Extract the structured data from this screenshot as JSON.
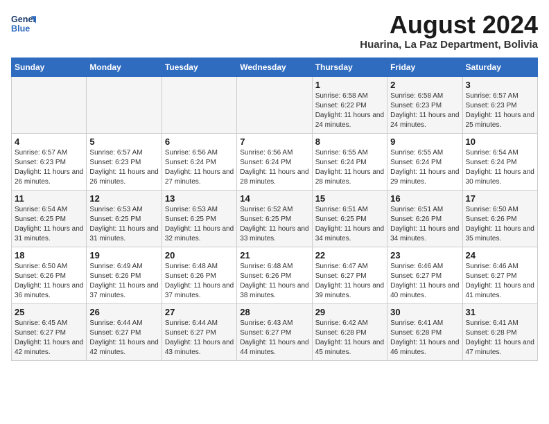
{
  "header": {
    "logo_line1": "General",
    "logo_line2": "Blue",
    "main_title": "August 2024",
    "subtitle": "Huarina, La Paz Department, Bolivia"
  },
  "days_of_week": [
    "Sunday",
    "Monday",
    "Tuesday",
    "Wednesday",
    "Thursday",
    "Friday",
    "Saturday"
  ],
  "weeks": [
    [
      {
        "day": "",
        "sunrise": "",
        "sunset": "",
        "daylight": ""
      },
      {
        "day": "",
        "sunrise": "",
        "sunset": "",
        "daylight": ""
      },
      {
        "day": "",
        "sunrise": "",
        "sunset": "",
        "daylight": ""
      },
      {
        "day": "",
        "sunrise": "",
        "sunset": "",
        "daylight": ""
      },
      {
        "day": "1",
        "sunrise": "Sunrise: 6:58 AM",
        "sunset": "Sunset: 6:22 PM",
        "daylight": "Daylight: 11 hours and 24 minutes."
      },
      {
        "day": "2",
        "sunrise": "Sunrise: 6:58 AM",
        "sunset": "Sunset: 6:23 PM",
        "daylight": "Daylight: 11 hours and 24 minutes."
      },
      {
        "day": "3",
        "sunrise": "Sunrise: 6:57 AM",
        "sunset": "Sunset: 6:23 PM",
        "daylight": "Daylight: 11 hours and 25 minutes."
      }
    ],
    [
      {
        "day": "4",
        "sunrise": "Sunrise: 6:57 AM",
        "sunset": "Sunset: 6:23 PM",
        "daylight": "Daylight: 11 hours and 26 minutes."
      },
      {
        "day": "5",
        "sunrise": "Sunrise: 6:57 AM",
        "sunset": "Sunset: 6:23 PM",
        "daylight": "Daylight: 11 hours and 26 minutes."
      },
      {
        "day": "6",
        "sunrise": "Sunrise: 6:56 AM",
        "sunset": "Sunset: 6:24 PM",
        "daylight": "Daylight: 11 hours and 27 minutes."
      },
      {
        "day": "7",
        "sunrise": "Sunrise: 6:56 AM",
        "sunset": "Sunset: 6:24 PM",
        "daylight": "Daylight: 11 hours and 28 minutes."
      },
      {
        "day": "8",
        "sunrise": "Sunrise: 6:55 AM",
        "sunset": "Sunset: 6:24 PM",
        "daylight": "Daylight: 11 hours and 28 minutes."
      },
      {
        "day": "9",
        "sunrise": "Sunrise: 6:55 AM",
        "sunset": "Sunset: 6:24 PM",
        "daylight": "Daylight: 11 hours and 29 minutes."
      },
      {
        "day": "10",
        "sunrise": "Sunrise: 6:54 AM",
        "sunset": "Sunset: 6:24 PM",
        "daylight": "Daylight: 11 hours and 30 minutes."
      }
    ],
    [
      {
        "day": "11",
        "sunrise": "Sunrise: 6:54 AM",
        "sunset": "Sunset: 6:25 PM",
        "daylight": "Daylight: 11 hours and 31 minutes."
      },
      {
        "day": "12",
        "sunrise": "Sunrise: 6:53 AM",
        "sunset": "Sunset: 6:25 PM",
        "daylight": "Daylight: 11 hours and 31 minutes."
      },
      {
        "day": "13",
        "sunrise": "Sunrise: 6:53 AM",
        "sunset": "Sunset: 6:25 PM",
        "daylight": "Daylight: 11 hours and 32 minutes."
      },
      {
        "day": "14",
        "sunrise": "Sunrise: 6:52 AM",
        "sunset": "Sunset: 6:25 PM",
        "daylight": "Daylight: 11 hours and 33 minutes."
      },
      {
        "day": "15",
        "sunrise": "Sunrise: 6:51 AM",
        "sunset": "Sunset: 6:25 PM",
        "daylight": "Daylight: 11 hours and 34 minutes."
      },
      {
        "day": "16",
        "sunrise": "Sunrise: 6:51 AM",
        "sunset": "Sunset: 6:26 PM",
        "daylight": "Daylight: 11 hours and 34 minutes."
      },
      {
        "day": "17",
        "sunrise": "Sunrise: 6:50 AM",
        "sunset": "Sunset: 6:26 PM",
        "daylight": "Daylight: 11 hours and 35 minutes."
      }
    ],
    [
      {
        "day": "18",
        "sunrise": "Sunrise: 6:50 AM",
        "sunset": "Sunset: 6:26 PM",
        "daylight": "Daylight: 11 hours and 36 minutes."
      },
      {
        "day": "19",
        "sunrise": "Sunrise: 6:49 AM",
        "sunset": "Sunset: 6:26 PM",
        "daylight": "Daylight: 11 hours and 37 minutes."
      },
      {
        "day": "20",
        "sunrise": "Sunrise: 6:48 AM",
        "sunset": "Sunset: 6:26 PM",
        "daylight": "Daylight: 11 hours and 37 minutes."
      },
      {
        "day": "21",
        "sunrise": "Sunrise: 6:48 AM",
        "sunset": "Sunset: 6:26 PM",
        "daylight": "Daylight: 11 hours and 38 minutes."
      },
      {
        "day": "22",
        "sunrise": "Sunrise: 6:47 AM",
        "sunset": "Sunset: 6:27 PM",
        "daylight": "Daylight: 11 hours and 39 minutes."
      },
      {
        "day": "23",
        "sunrise": "Sunrise: 6:46 AM",
        "sunset": "Sunset: 6:27 PM",
        "daylight": "Daylight: 11 hours and 40 minutes."
      },
      {
        "day": "24",
        "sunrise": "Sunrise: 6:46 AM",
        "sunset": "Sunset: 6:27 PM",
        "daylight": "Daylight: 11 hours and 41 minutes."
      }
    ],
    [
      {
        "day": "25",
        "sunrise": "Sunrise: 6:45 AM",
        "sunset": "Sunset: 6:27 PM",
        "daylight": "Daylight: 11 hours and 42 minutes."
      },
      {
        "day": "26",
        "sunrise": "Sunrise: 6:44 AM",
        "sunset": "Sunset: 6:27 PM",
        "daylight": "Daylight: 11 hours and 42 minutes."
      },
      {
        "day": "27",
        "sunrise": "Sunrise: 6:44 AM",
        "sunset": "Sunset: 6:27 PM",
        "daylight": "Daylight: 11 hours and 43 minutes."
      },
      {
        "day": "28",
        "sunrise": "Sunrise: 6:43 AM",
        "sunset": "Sunset: 6:27 PM",
        "daylight": "Daylight: 11 hours and 44 minutes."
      },
      {
        "day": "29",
        "sunrise": "Sunrise: 6:42 AM",
        "sunset": "Sunset: 6:28 PM",
        "daylight": "Daylight: 11 hours and 45 minutes."
      },
      {
        "day": "30",
        "sunrise": "Sunrise: 6:41 AM",
        "sunset": "Sunset: 6:28 PM",
        "daylight": "Daylight: 11 hours and 46 minutes."
      },
      {
        "day": "31",
        "sunrise": "Sunrise: 6:41 AM",
        "sunset": "Sunset: 6:28 PM",
        "daylight": "Daylight: 11 hours and 47 minutes."
      }
    ]
  ]
}
